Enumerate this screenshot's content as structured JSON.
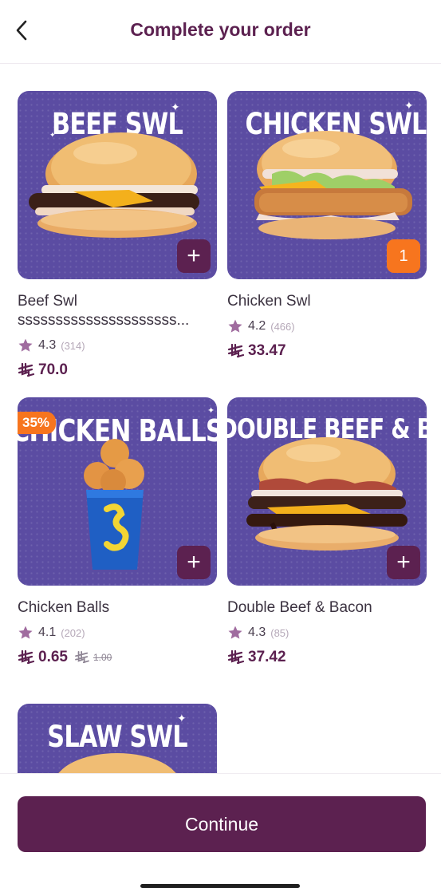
{
  "header": {
    "title": "Complete your order",
    "back_icon": "chevron-left-icon"
  },
  "products": [
    {
      "banner": "BEEF SWL",
      "name": "Beef Swl",
      "name_line2": "sssssssssssssssssssss...",
      "rating": "4.3",
      "rating_count": "(314)",
      "price": "70.0",
      "action": "+"
    },
    {
      "banner": "CHICKEN SWL",
      "name": "Chicken Swl",
      "rating": "4.2",
      "rating_count": "(466)",
      "price": "33.47",
      "quantity": "1"
    },
    {
      "banner": "CHICKEN BALLS",
      "discount_badge": "35%",
      "name": "Chicken Balls",
      "rating": "4.1",
      "rating_count": "(202)",
      "price": "0.65",
      "old_price": "1.00",
      "action": "+"
    },
    {
      "banner": "DOUBLE BEEF & BACON",
      "name": "Double Beef & Bacon",
      "rating": "4.3",
      "rating_count": "(85)",
      "price": "37.42",
      "action": "+"
    },
    {
      "banner": "SLAW SWL"
    }
  ],
  "footer": {
    "continue_label": "Continue"
  },
  "colors": {
    "brand": "#5c2150",
    "accent_orange": "#f7751e",
    "tile_background": "#5b4ca2",
    "star": "#a06c9f"
  }
}
